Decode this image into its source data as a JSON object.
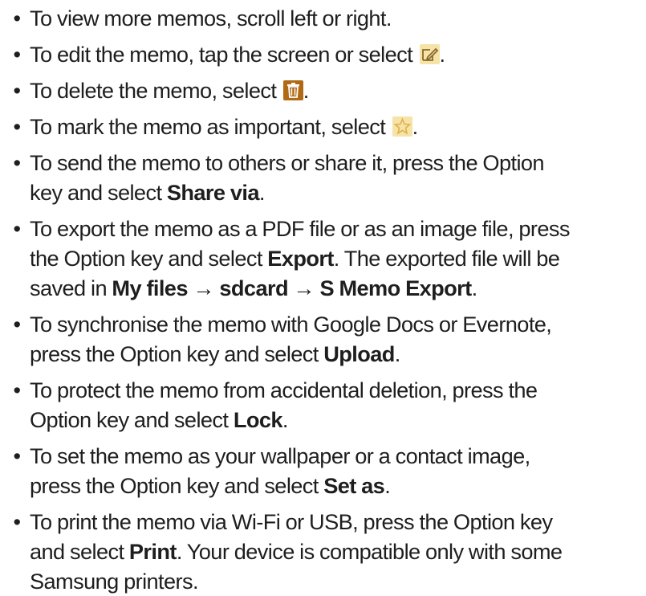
{
  "bullet": "•",
  "arrow": "→",
  "items": [
    {
      "text": "To view more memos, scroll left or right."
    },
    {
      "text": "To edit the memo, tap the screen or select",
      "icon": "edit-icon",
      "after": "."
    },
    {
      "text": "To delete the memo, select",
      "icon": "delete-icon",
      "after": "."
    },
    {
      "text": "To mark the memo as important, select",
      "icon": "star-icon",
      "after": "."
    },
    {
      "line1": "To send the memo to others or share it, press the Option",
      "line2_pre": "key and select ",
      "bold": "Share via",
      "line2_post": "."
    },
    {
      "line1": "To export the memo as a PDF file or as an image file, press",
      "line2_pre": "the Option key and select ",
      "bold": "Export",
      "line2_post": ". The exported file will be",
      "line3_pre": "saved in ",
      "path": [
        "My files",
        "sdcard",
        "S Memo Export"
      ],
      "line3_post": "."
    },
    {
      "line1": "To synchronise the memo with Google Docs or Evernote,",
      "line2_pre": "press the Option key and select ",
      "bold": "Upload",
      "line2_post": "."
    },
    {
      "line1": "To protect the memo from accidental deletion, press the",
      "line2_pre": "Option key and select ",
      "bold": "Lock",
      "line2_post": "."
    },
    {
      "line1": "To set the memo as your wallpaper or a contact image,",
      "line2_pre": "press the Option key and select ",
      "bold": "Set as",
      "line2_post": "."
    },
    {
      "line1": "To print the memo via Wi-Fi or USB, press the Option key",
      "line2_pre": "and select ",
      "bold": "Print",
      "line2_post": ". Your device is compatible only with some",
      "line3": "Samsung printers."
    }
  ],
  "colors": {
    "text": "#1e1e1e",
    "icon_bg": "#f6e3a8",
    "icon_stroke": "#8a6a2c",
    "delete_bg": "#b06a16",
    "star": "#e0b04a"
  }
}
